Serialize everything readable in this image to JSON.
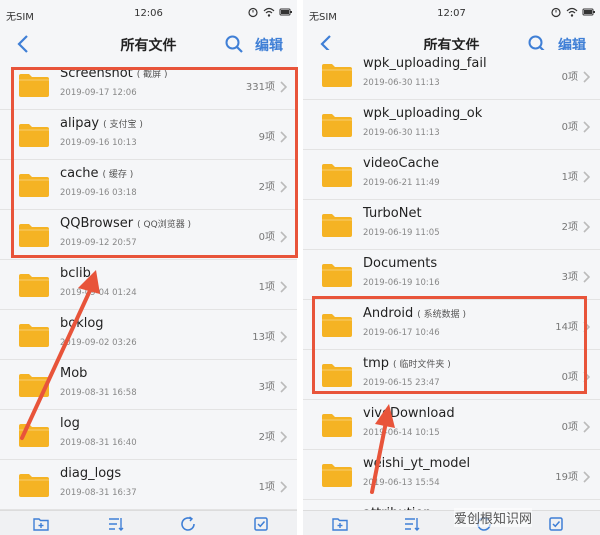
{
  "panels": [
    {
      "status": {
        "carrier": "无SIM",
        "time": "12:06"
      },
      "nav": {
        "title": "所有文件",
        "edit": "编辑"
      },
      "items": [
        {
          "name": "Screenshot",
          "sub": "( 截屏 )",
          "date": "2019-09-17 12:06",
          "count": "331项"
        },
        {
          "name": "alipay",
          "sub": "( 支付宝 )",
          "date": "2019-09-16 10:13",
          "count": "9项"
        },
        {
          "name": "cache",
          "sub": "( 缓存 )",
          "date": "2019-09-16 03:18",
          "count": "2项"
        },
        {
          "name": "QQBrowser",
          "sub": "( QQ浏览器 )",
          "date": "2019-09-12 20:57",
          "count": "0项"
        },
        {
          "name": "bclib",
          "sub": "",
          "date": "2019-09-04 01:24",
          "count": "1项"
        },
        {
          "name": "boklog",
          "sub": "",
          "date": "2019-09-02 03:26",
          "count": "13项"
        },
        {
          "name": "Mob",
          "sub": "",
          "date": "2019-08-31 16:58",
          "count": "3项"
        },
        {
          "name": "log",
          "sub": "",
          "date": "2019-08-31 16:40",
          "count": "2项"
        },
        {
          "name": "diag_logs",
          "sub": "",
          "date": "2019-08-31 16:37",
          "count": "1项"
        }
      ]
    },
    {
      "status": {
        "carrier": "无SIM",
        "time": "12:07"
      },
      "nav": {
        "title": "所有文件",
        "edit": "编辑"
      },
      "items": [
        {
          "name": "wpk_uploading_fail",
          "sub": "",
          "date": "2019-06-30 11:13",
          "count": "0项"
        },
        {
          "name": "wpk_uploading_ok",
          "sub": "",
          "date": "2019-06-30 11:13",
          "count": "0项"
        },
        {
          "name": "videoCache",
          "sub": "",
          "date": "2019-06-21 11:49",
          "count": "1项"
        },
        {
          "name": "TurboNet",
          "sub": "",
          "date": "2019-06-19 11:05",
          "count": "2项"
        },
        {
          "name": "Documents",
          "sub": "",
          "date": "2019-06-19 10:16",
          "count": "3项"
        },
        {
          "name": "Android",
          "sub": "( 系统数据 )",
          "date": "2019-06-17 10:46",
          "count": "14项"
        },
        {
          "name": "tmp",
          "sub": "( 临时文件夹 )",
          "date": "2019-06-15 23:47",
          "count": "0项"
        },
        {
          "name": "vivoDownload",
          "sub": "",
          "date": "2019-06-14 10:15",
          "count": "0项"
        },
        {
          "name": "weishi_yt_model",
          "sub": "",
          "date": "2019-06-13 15:54",
          "count": "19项"
        },
        {
          "name": "attribution",
          "sub": "",
          "date": "",
          "count": ""
        }
      ]
    }
  ],
  "icons": {
    "back": "back-arrow-icon",
    "search": "search-icon",
    "folder": "folder-icon",
    "chevron": "chevron-right-icon",
    "toolbar": [
      "new-folder-icon",
      "sort-icon",
      "refresh-icon",
      "select-all-icon"
    ]
  },
  "colors": {
    "accent": "#3f7fd6",
    "folder": "#f5b324",
    "highlight": "#e8543a",
    "background": "#f5f6f8"
  },
  "watermark": "爱创根知识网"
}
